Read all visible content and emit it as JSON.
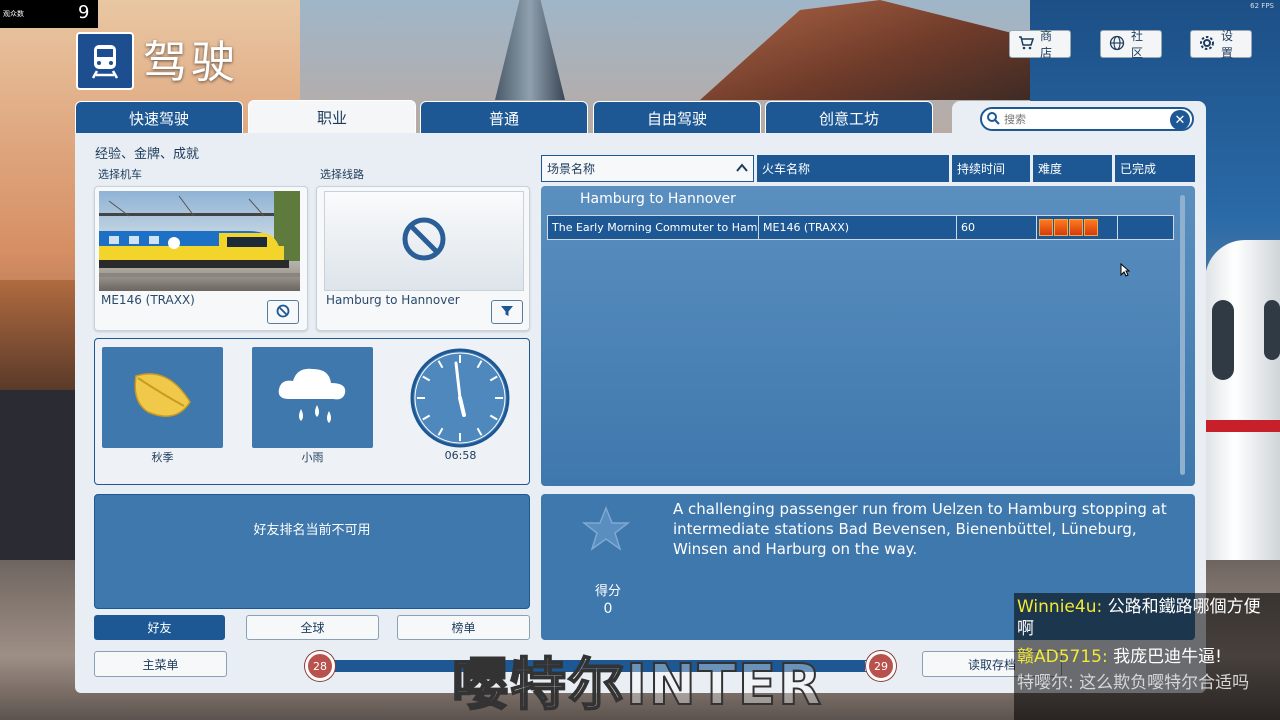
{
  "overlay": {
    "fans_label": "观众数",
    "fans_value": "9",
    "fps": "62 FPS"
  },
  "header": {
    "title": "驾驶",
    "buttons": {
      "store": "商店",
      "community": "社区",
      "settings": "设置"
    }
  },
  "tabs": [
    "快速驾驶",
    "职业",
    "普通",
    "自由驾驶",
    "创意工坊"
  ],
  "search": {
    "placeholder": "搜索"
  },
  "career": {
    "section_title": "经验、金牌、成就",
    "loco_label": "选择机车",
    "route_label": "选择线路",
    "loco_name": "ME146 (TRAXX)",
    "route_name": "Hamburg to Hannover"
  },
  "environment": {
    "season": "秋季",
    "weather": "小雨",
    "time": "06:58"
  },
  "leaderboard": {
    "unavailable_msg": "好友排名当前不可用",
    "buttons": [
      "好友",
      "全球",
      "榜单"
    ]
  },
  "bottom": {
    "main_menu": "主菜单",
    "load_save": "读取存档",
    "level_left": "28",
    "level_right": "29",
    "progress": 0.97
  },
  "table": {
    "headers": [
      "场景名称",
      "火车名称",
      "持续时间",
      "难度",
      "已完成"
    ],
    "group": "Hamburg to Hannover",
    "rows": [
      {
        "scenario": "The Early Morning Commuter to Hamburg",
        "train": "ME146 (TRAXX)",
        "duration": "60",
        "difficulty": 4,
        "completed": ""
      }
    ]
  },
  "description": {
    "text": "A challenging passenger run from Uelzen to Hamburg stopping at intermediate stations Bad Bevensen, Bienenbüttel, Lüneburg, Winsen and Harburg on the way.",
    "score_label": "得分",
    "score_value": "0"
  },
  "watermark": "嘤特尔INTER",
  "chat": [
    {
      "user": "Winnie4u",
      "message": "公路和鐵路哪個方便啊"
    },
    {
      "user": "赣AD5715",
      "message": "我庞巴迪牛逼!"
    },
    {
      "user": "特嘤尔",
      "message": "这么欺负嘤特尔合适吗"
    }
  ]
}
